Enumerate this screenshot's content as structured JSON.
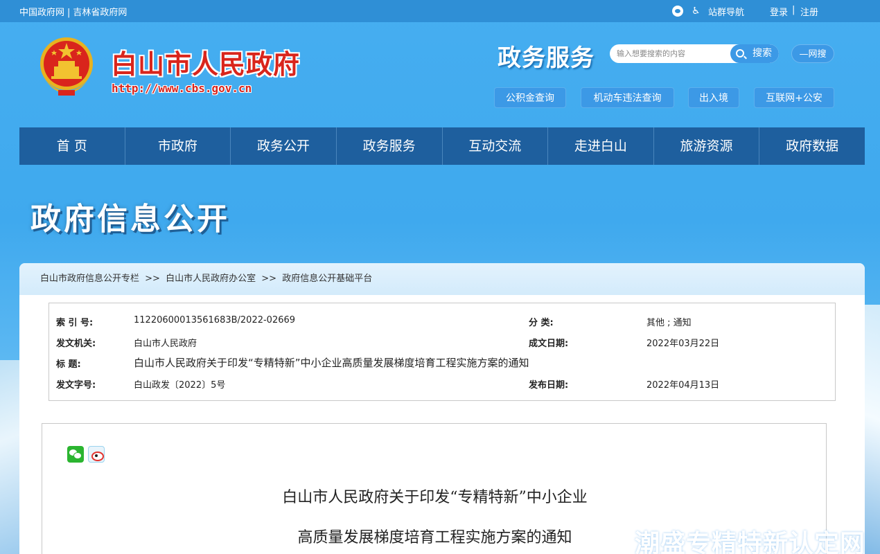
{
  "topbar": {
    "left_links": [
      "中国政府网",
      "吉林省政府网"
    ],
    "separator": "|",
    "site_nav": "站群导航",
    "login": "登录",
    "register": "注册",
    "login_sep": "|"
  },
  "header": {
    "site_title": "白山市人民政府",
    "site_url": "http://www.cbs.gov.cn",
    "service_title": "政务服务",
    "search_placeholder": "输入想要搜索的内容",
    "search_button": "搜索",
    "web_search": "—网搜",
    "quick_links": [
      "公积金查询",
      "机动车违法查询",
      "出入境",
      "互联网+公安"
    ]
  },
  "nav": {
    "items": [
      "首 页",
      "市政府",
      "政务公开",
      "政务服务",
      "互动交流",
      "走进白山",
      "旅游资源",
      "政府数据"
    ]
  },
  "banner": {
    "title": "政府信息公开"
  },
  "breadcrumb": {
    "items": [
      "白山市政府信息公开专栏",
      "白山市人民政府办公室",
      "政府信息公开基础平台"
    ],
    "arrow": ">>"
  },
  "meta": {
    "index_label": "索 引 号:",
    "index_value": "11220600013561683B/2022-02669",
    "category_label": "分 类:",
    "category_value": "其他 ; 通知",
    "issuer_label": "发文机关:",
    "issuer_value": "白山市人民政府",
    "date_label": "成文日期:",
    "date_value": "2022年03月22日",
    "title_label": "标 题:",
    "title_value": "白山市人民政府关于印发“专精特新”中小企业高质量发展梯度培育工程实施方案的通知",
    "docno_label": "发文字号:",
    "docno_value": "白山政发〔2022〕5号",
    "pub_label": "发布日期:",
    "pub_value": "2022年04月13日"
  },
  "document": {
    "title_line1": "白山市人民政府关于印发“专精特新”中小企业",
    "title_line2": "高质量发展梯度培育工程实施方案的通知"
  },
  "watermark": {
    "text": "潮盛专精特新认定网"
  }
}
